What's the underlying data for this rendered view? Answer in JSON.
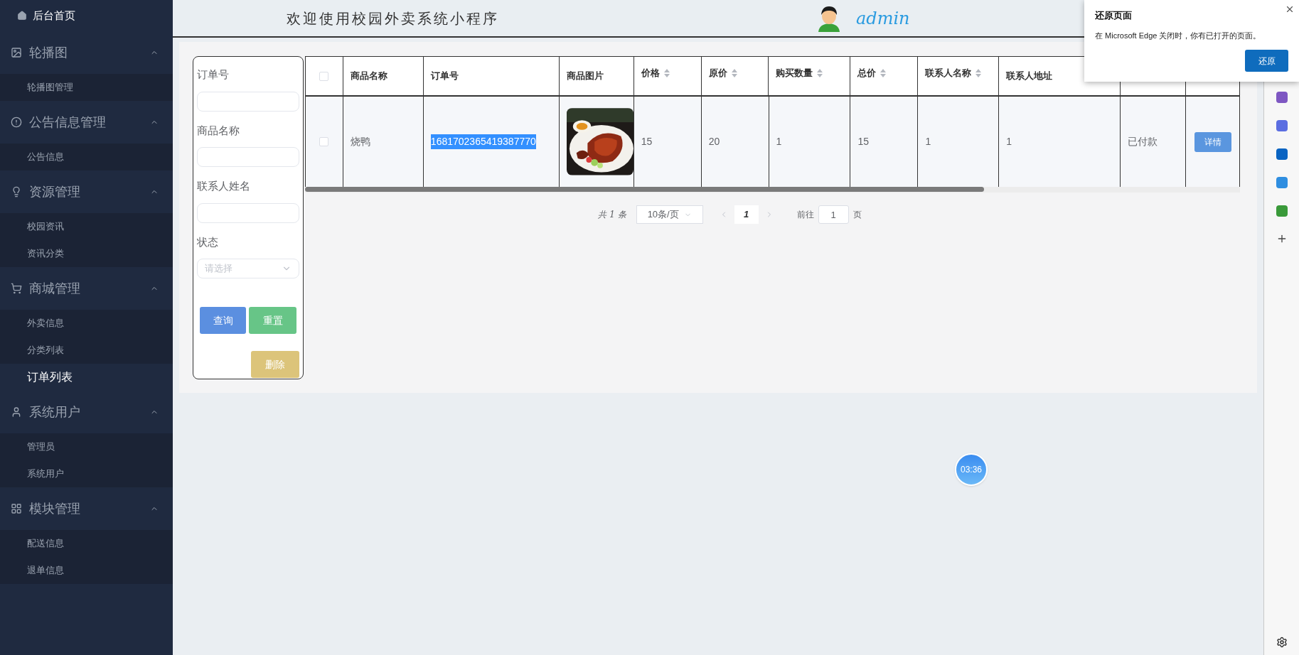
{
  "sidebar": {
    "home": {
      "label": "后台首页"
    },
    "groups": [
      {
        "label": "轮播图",
        "expanded": true,
        "items": [
          {
            "label": "轮播图管理",
            "selected": false
          }
        ]
      },
      {
        "label": "公告信息管理",
        "expanded": true,
        "items": [
          {
            "label": "公告信息",
            "selected": false
          }
        ]
      },
      {
        "label": "资源管理",
        "expanded": true,
        "items": [
          {
            "label": "校园资讯",
            "selected": false
          },
          {
            "label": "资讯分类",
            "selected": false
          }
        ]
      },
      {
        "label": "商城管理",
        "expanded": true,
        "items": [
          {
            "label": "外卖信息",
            "selected": false
          },
          {
            "label": "分类列表",
            "selected": false
          },
          {
            "label": "订单列表",
            "selected": true
          }
        ]
      },
      {
        "label": "系统用户",
        "expanded": true,
        "items": [
          {
            "label": "管理员",
            "selected": false
          },
          {
            "label": "系统用户",
            "selected": false
          }
        ]
      },
      {
        "label": "模块管理",
        "expanded": true,
        "items": [
          {
            "label": "配送信息",
            "selected": false
          },
          {
            "label": "退单信息",
            "selected": false
          }
        ]
      }
    ]
  },
  "header": {
    "title": "欢迎使用校园外卖系统小程序",
    "user": "admin"
  },
  "filter": {
    "fields": [
      {
        "label": "订单号",
        "kind": "text"
      },
      {
        "label": "商品名称",
        "kind": "text"
      },
      {
        "label": "联系人姓名",
        "kind": "text"
      },
      {
        "label": "状态",
        "kind": "select",
        "placeholder": "请选择"
      }
    ],
    "buttons": [
      {
        "label": "查询",
        "kind": "query"
      },
      {
        "label": "重置",
        "kind": "reset"
      },
      {
        "label": "删除",
        "kind": "delete"
      }
    ]
  },
  "table": {
    "all_checked": false,
    "columns": [
      {
        "label": "商品名称",
        "sortable": false
      },
      {
        "label": "订单号",
        "sortable": false
      },
      {
        "label": "商品图片",
        "sortable": false
      },
      {
        "label": "价格",
        "sortable": true
      },
      {
        "label": "原价",
        "sortable": true
      },
      {
        "label": "购买数量",
        "sortable": true
      },
      {
        "label": "总价",
        "sortable": true
      },
      {
        "label": "联系人名称",
        "sortable": true
      },
      {
        "label": "联系人地址",
        "sortable": false
      }
    ],
    "rows": [
      {
        "checked": false,
        "cells": [
          {
            "kind": "text",
            "text": "烧鸭"
          },
          {
            "kind": "text",
            "text": "1681702365419387770",
            "highlighted": true
          },
          {
            "kind": "picture"
          },
          {
            "kind": "text",
            "text": "15"
          },
          {
            "kind": "text",
            "text": "20"
          },
          {
            "kind": "text",
            "text": "1"
          },
          {
            "kind": "text",
            "text": "15"
          },
          {
            "kind": "text",
            "text": "1"
          },
          {
            "kind": "text",
            "text": "1"
          },
          {
            "kind": "text",
            "text": "已付款"
          },
          {
            "kind": "button",
            "text": "详情"
          }
        ]
      }
    ]
  },
  "pagination": {
    "total": "共 1 条",
    "page_size": "10条/页",
    "pages": [
      {
        "label": "1",
        "selected": true
      }
    ],
    "goto_label": "前往",
    "goto_value": "1",
    "goto_unit": "页"
  },
  "timer": "03:36",
  "popup": {
    "title": "还原页面",
    "message": "在 Microsoft Edge 关闭时，你有已打开的页面。",
    "button": "还原"
  }
}
